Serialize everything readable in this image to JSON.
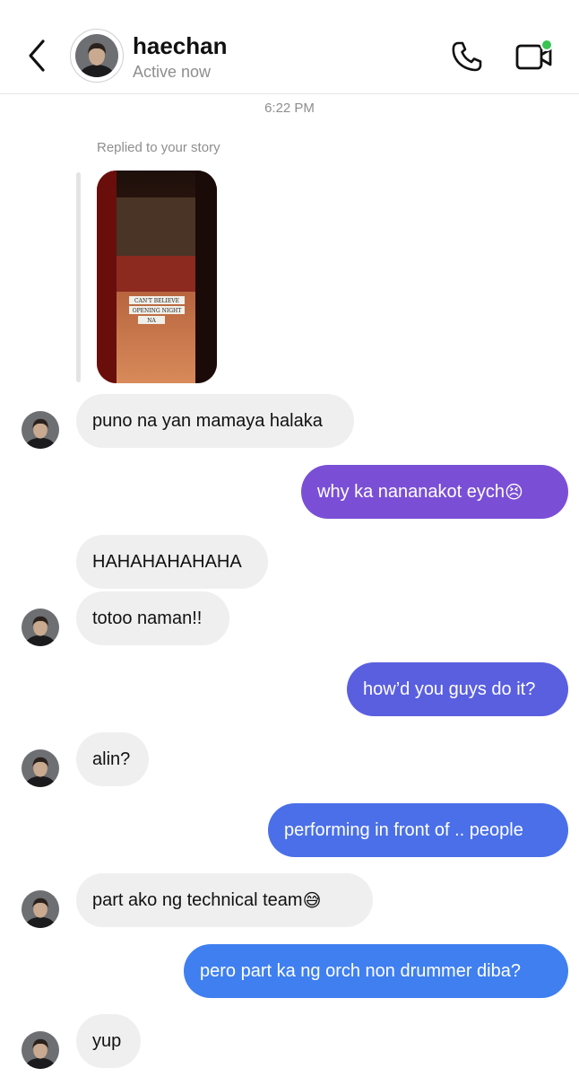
{
  "header": {
    "name": "haechan",
    "status": "Active now"
  },
  "timestamp": "6:22 PM",
  "story_reply": {
    "label": "Replied to your story",
    "story_text": [
      "CAN'T BELIEVE",
      "OPENING NIGHT",
      "NA"
    ]
  },
  "messages": [
    {
      "side": "in",
      "text": "puno na yan mamaya halaka"
    },
    {
      "side": "out",
      "text": "why ka nananakot eych",
      "emoji": "😣"
    },
    {
      "side": "in",
      "text": "HAHAHAHAHAHA"
    },
    {
      "side": "in",
      "text": "totoo naman!!"
    },
    {
      "side": "out",
      "text": "how’d you guys do it?"
    },
    {
      "side": "in",
      "text": "alin?"
    },
    {
      "side": "out",
      "text": "performing in front of .. people"
    },
    {
      "side": "in",
      "text": "part ako ng technical team",
      "emoji": "😅"
    },
    {
      "side": "out",
      "text": "pero part ka ng orch non drummer diba?"
    },
    {
      "side": "in",
      "text": "yup"
    }
  ],
  "colors": {
    "out_gradient": [
      "#7a4fd6",
      "#5a5fe0",
      "#4a6fe8",
      "#3f7ff0"
    ],
    "incoming": "#efefef",
    "online_dot": "#39c454"
  },
  "icons": [
    "back-chevron-icon",
    "phone-icon",
    "video-camera-icon",
    "online-dot-icon"
  ]
}
